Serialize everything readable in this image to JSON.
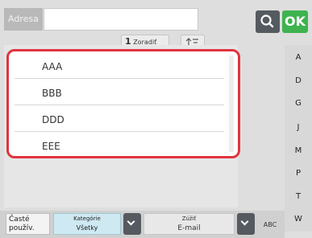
{
  "header": {
    "address_placeholder": "Adresa",
    "ok_label": "OK",
    "sort_number": "1",
    "sort_label": "Zoradiť"
  },
  "list": {
    "items": [
      "AAA",
      "BBB",
      "DDD",
      "EEE"
    ]
  },
  "index": [
    "A",
    "D",
    "G",
    "J",
    "M",
    "P",
    "T",
    "W"
  ],
  "footer": {
    "frequent_label": "Časté použív.",
    "category_caption": "Kategórie",
    "category_value": "Všetky",
    "select_caption": "Zúžiť",
    "select_value": "E-mail",
    "abc_label": "ABC"
  },
  "colors": {
    "highlight": "#e0343f",
    "ok": "#3fb34f",
    "dark_button": "#555a60",
    "category": "#cfe9f2"
  }
}
